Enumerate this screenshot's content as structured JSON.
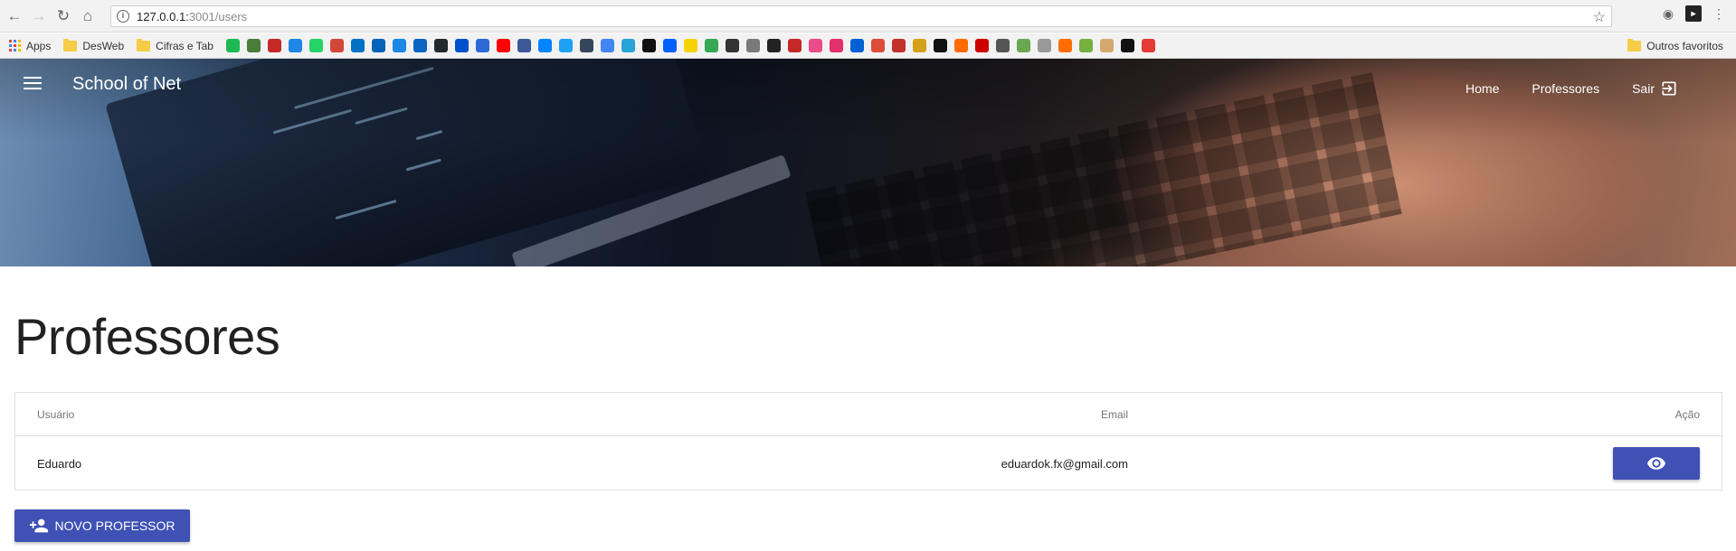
{
  "browser": {
    "url_host": "127.0.0.1:",
    "url_path": "3001/users"
  },
  "bookmarks": {
    "apps_label": "Apps",
    "folders": [
      "DesWeb",
      "Cifras e Tab"
    ],
    "favicon_colors": [
      "#1db954",
      "#4a7c3a",
      "#c62828",
      "#1e88e5",
      "#25d366",
      "#d44638",
      "#0072c6",
      "#0364b8",
      "#1e88e5",
      "#0a66c2",
      "#24292e",
      "#0052cc",
      "#2d6ad8",
      "#ff0000",
      "#3b5998",
      "#0084ff",
      "#1da1f2",
      "#35465c",
      "#4285f4",
      "#2aa3d6",
      "#111111",
      "#0061fe",
      "#f5d300",
      "#34a853",
      "#333333",
      "#7a7a7a",
      "#222222",
      "#c62828",
      "#ea4c89",
      "#e1306c",
      "#0061d5",
      "#dd4b39",
      "#c4302b",
      "#d4a017",
      "#111111",
      "#ff6b00",
      "#cc0000",
      "#555555",
      "#6aa84f",
      "#999999",
      "#ff6d00",
      "#76b041",
      "#d5a96e",
      "#111111",
      "#e53935"
    ],
    "other_favorites": "Outros favoritos"
  },
  "header": {
    "brand": "School of Net",
    "nav": [
      "Home",
      "Professores",
      "Sair"
    ]
  },
  "main": {
    "title": "Professores",
    "table": {
      "columns": [
        "Usuário",
        "Email",
        "Ação"
      ],
      "rows": [
        {
          "user": "Eduardo",
          "email": "eduardok.fx@gmail.com"
        }
      ]
    },
    "new_button_label": "NOVO PROFESSOR"
  },
  "colors": {
    "primary": "#3f51b5"
  }
}
